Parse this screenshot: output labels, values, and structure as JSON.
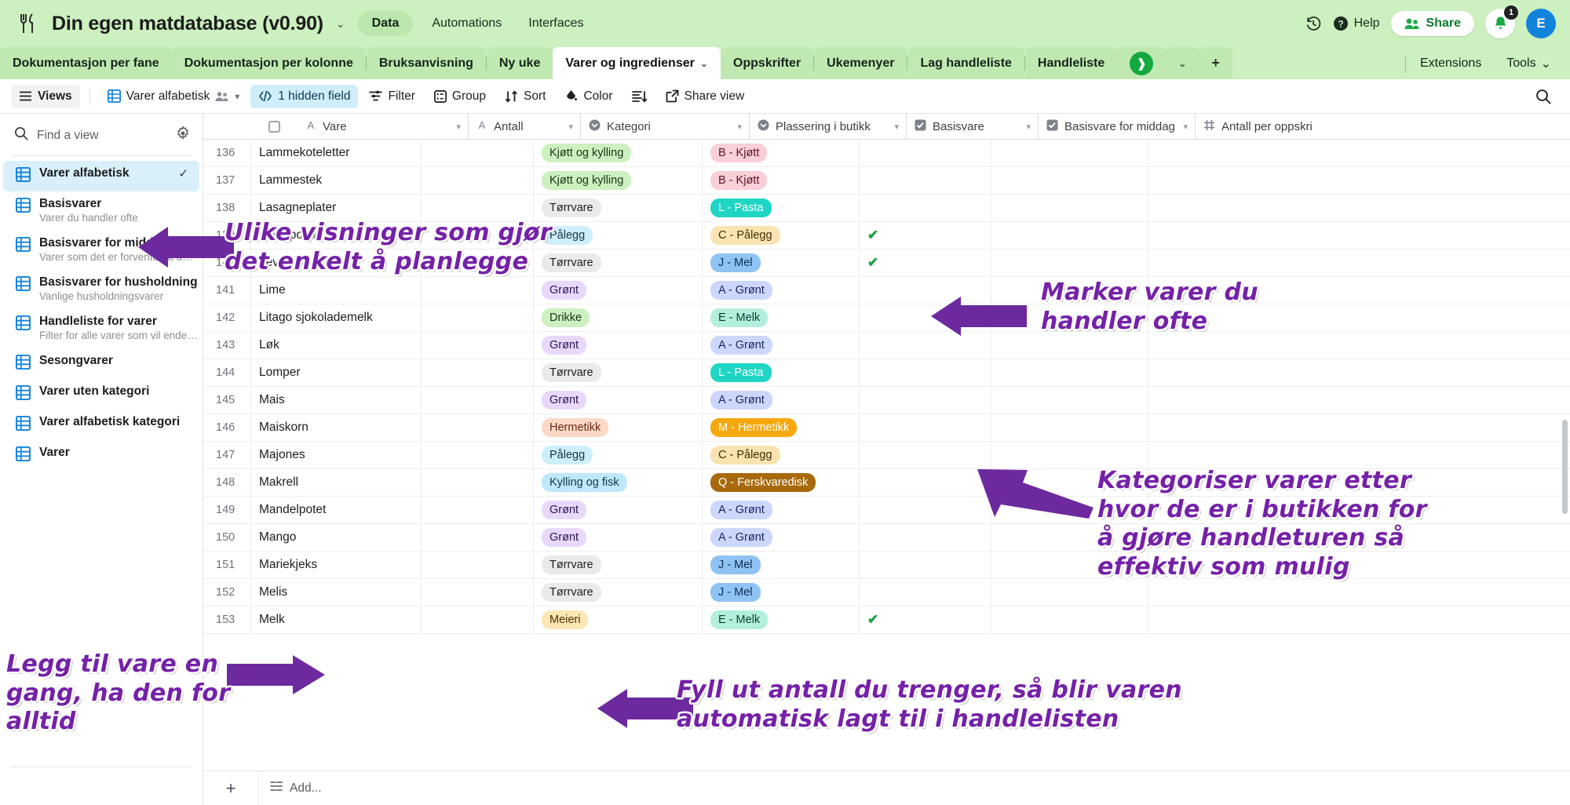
{
  "header": {
    "brand_icon": "fork-knife-icon",
    "title": "Din egen matdatabase (v0.90)",
    "title_caret": "⌄",
    "nav": [
      {
        "label": "Data",
        "active": true
      },
      {
        "label": "Automations",
        "active": false
      },
      {
        "label": "Interfaces",
        "active": false
      }
    ],
    "history_icon": "history-clock-icon",
    "help_label": "Help",
    "share_label": "Share",
    "notification_count": "1",
    "avatar_initial": "E"
  },
  "tabs": {
    "items": [
      {
        "label": "Dokumentasjon per fane",
        "state": "shaded"
      },
      {
        "label": "Dokumentasjon per kolonne",
        "state": "normal"
      },
      {
        "label": "Bruksanvisning",
        "state": "normal"
      },
      {
        "label": "Ny uke",
        "state": "normal"
      },
      {
        "label": "Varer og ingredienser",
        "state": "active"
      },
      {
        "label": "Oppskrifter",
        "state": "normal"
      },
      {
        "label": "Ukemenyer",
        "state": "normal"
      },
      {
        "label": "Lag handleliste",
        "state": "normal"
      },
      {
        "label": "Handleliste",
        "state": "normal"
      }
    ],
    "overflow_caret": "⌄",
    "add_label": "+",
    "extensions_label": "Extensions",
    "tools_label": "Tools",
    "tools_caret": "⌄"
  },
  "toolbar": {
    "views_label": "Views",
    "view_name": "Varer alfabetisk",
    "view_collaborators_icon": "people-icon",
    "view_caret": "▾",
    "hidden_field_label": "1 hidden field",
    "filter_label": "Filter",
    "group_label": "Group",
    "sort_label": "Sort",
    "color_label": "Color",
    "row_height_icon": "row-height-icon",
    "share_view_label": "Share view",
    "search_icon": "search-icon"
  },
  "sidebar": {
    "find_placeholder": "Find a view",
    "settings_icon": "gear-icon",
    "views": [
      {
        "name": "Varer alfabetisk",
        "sub": "",
        "selected": true,
        "checked": true
      },
      {
        "name": "Basisvarer",
        "sub": "Varer du handler ofte",
        "selected": false,
        "checked": false
      },
      {
        "name": "Basisvarer for middag",
        "sub": "Varer som det er forventet at d…",
        "selected": false,
        "checked": false
      },
      {
        "name": "Basisvarer for husholdning",
        "sub": "Vanlige husholdningsvarer",
        "selected": false,
        "checked": false
      },
      {
        "name": "Handleliste for varer",
        "sub": "Filter for alle varer som vil ende…",
        "selected": false,
        "checked": false
      },
      {
        "name": "Sesongvarer",
        "sub": "",
        "selected": false,
        "checked": false
      },
      {
        "name": "Varer uten kategori",
        "sub": "",
        "selected": false,
        "checked": false
      },
      {
        "name": "Varer alfabetisk kategori",
        "sub": "",
        "selected": false,
        "checked": false
      },
      {
        "name": "Varer",
        "sub": "",
        "selected": false,
        "checked": false
      }
    ]
  },
  "grid": {
    "columns": [
      {
        "label": "Vare",
        "icon": "text-field-icon",
        "caret": "▾"
      },
      {
        "label": "Antall",
        "icon": "text-field-icon",
        "caret": "▾"
      },
      {
        "label": "Kategori",
        "icon": "single-select-icon",
        "caret": "▾"
      },
      {
        "label": "Plassering i butikk",
        "icon": "single-select-icon",
        "caret": "▾"
      },
      {
        "label": "Basisvare",
        "icon": "checkbox-icon",
        "caret": "▾"
      },
      {
        "label": "Basisvare for middag",
        "icon": "checkbox-icon",
        "caret": "▾"
      },
      {
        "label": "Antall per oppskri",
        "icon": "plus-field-icon",
        "caret": ""
      }
    ],
    "rows": [
      {
        "num": "136",
        "vare": "Lammekoteletter",
        "antall": "",
        "kategori": "Kjøtt og kylling",
        "kat_style": "green",
        "plassering": "B - Kjøtt",
        "plass_style": "pink",
        "basisvare": "",
        "basisvare_middag": "",
        "antall_per": ""
      },
      {
        "num": "137",
        "vare": "Lammestek",
        "antall": "",
        "kategori": "Kjøtt og kylling",
        "kat_style": "green",
        "plassering": "B - Kjøtt",
        "plass_style": "pink",
        "basisvare": "",
        "basisvare_middag": "",
        "antall_per": ""
      },
      {
        "num": "138",
        "vare": "Lasagneplater",
        "antall": "",
        "kategori": "Tørrvare",
        "kat_style": "gray",
        "plassering": "L - Pasta",
        "plass_style": "teal",
        "basisvare": "",
        "basisvare_middag": "",
        "antall_per": ""
      },
      {
        "num": "139",
        "vare": "Leverpostei",
        "antall": "",
        "kategori": "Pålegg",
        "kat_style": "lightblue",
        "plassering": "C - Pålegg",
        "plass_style": "cream",
        "basisvare": "✔",
        "basisvare_middag": "",
        "antall_per": ""
      },
      {
        "num": "140",
        "vare": "Leverpostei gul",
        "antall": "",
        "kategori": "Tørrvare",
        "kat_style": "gray",
        "plassering": "J - Mel",
        "plass_style": "blue",
        "basisvare": "✔",
        "basisvare_middag": "",
        "antall_per": ""
      },
      {
        "num": "141",
        "vare": "Lime",
        "antall": "",
        "kategori": "Grønt",
        "kat_style": "purple",
        "plassering": "A - Grønt",
        "plass_style": "periwinkle",
        "basisvare": "",
        "basisvare_middag": "",
        "antall_per": ""
      },
      {
        "num": "142",
        "vare": "Litago sjokolademelk",
        "antall": "",
        "kategori": "Drikke",
        "kat_style": "green",
        "plassering": "E - Melk",
        "plass_style": "mint",
        "basisvare": "",
        "basisvare_middag": "",
        "antall_per": ""
      },
      {
        "num": "143",
        "vare": "Løk",
        "antall": "",
        "kategori": "Grønt",
        "kat_style": "purple",
        "plassering": "A - Grønt",
        "plass_style": "periwinkle",
        "basisvare": "",
        "basisvare_middag": "",
        "antall_per": ""
      },
      {
        "num": "144",
        "vare": "Lomper",
        "antall": "",
        "kategori": "Tørrvare",
        "kat_style": "gray",
        "plassering": "L - Pasta",
        "plass_style": "teal",
        "basisvare": "",
        "basisvare_middag": "",
        "antall_per": ""
      },
      {
        "num": "145",
        "vare": "Mais",
        "antall": "",
        "kategori": "Grønt",
        "kat_style": "purple",
        "plassering": "A - Grønt",
        "plass_style": "periwinkle",
        "basisvare": "",
        "basisvare_middag": "",
        "antall_per": ""
      },
      {
        "num": "146",
        "vare": "Maiskorn",
        "antall": "",
        "kategori": "Hermetikk",
        "kat_style": "peach",
        "plassering": "M - Hermetikk",
        "plass_style": "orange",
        "basisvare": "",
        "basisvare_middag": "",
        "antall_per": ""
      },
      {
        "num": "147",
        "vare": "Majones",
        "antall": "",
        "kategori": "Pålegg",
        "kat_style": "lightblue",
        "plassering": "C - Pålegg",
        "plass_style": "cream",
        "basisvare": "",
        "basisvare_middag": "",
        "antall_per": ""
      },
      {
        "num": "148",
        "vare": "Makrell",
        "antall": "",
        "kategori": "Kylling og fisk",
        "kat_style": "skyblue",
        "plassering": "Q - Ferskvaredisk",
        "plass_style": "brown",
        "basisvare": "",
        "basisvare_middag": "",
        "antall_per": ""
      },
      {
        "num": "149",
        "vare": "Mandelpotet",
        "antall": "",
        "kategori": "Grønt",
        "kat_style": "purple",
        "plassering": "A - Grønt",
        "plass_style": "periwinkle",
        "basisvare": "",
        "basisvare_middag": "",
        "antall_per": ""
      },
      {
        "num": "150",
        "vare": "Mango",
        "antall": "",
        "kategori": "Grønt",
        "kat_style": "purple",
        "plassering": "A - Grønt",
        "plass_style": "periwinkle",
        "basisvare": "",
        "basisvare_middag": "",
        "antall_per": ""
      },
      {
        "num": "151",
        "vare": "Mariekjeks",
        "antall": "",
        "kategori": "Tørrvare",
        "kat_style": "gray",
        "plassering": "J - Mel",
        "plass_style": "blue",
        "basisvare": "",
        "basisvare_middag": "",
        "antall_per": ""
      },
      {
        "num": "152",
        "vare": "Melis",
        "antall": "",
        "kategori": "Tørrvare",
        "kat_style": "gray",
        "plassering": "J - Mel",
        "plass_style": "blue",
        "basisvare": "",
        "basisvare_middag": "",
        "antall_per": ""
      },
      {
        "num": "153",
        "vare": "Melk",
        "antall": "",
        "kategori": "Meieri",
        "kat_style": "cream2",
        "plassering": "E - Melk",
        "plass_style": "mint",
        "basisvare": "✔",
        "basisvare_middag": "",
        "antall_per": ""
      }
    ],
    "add_row_label": "Add...",
    "add_plus": "+"
  },
  "annotations": [
    {
      "id": "anno-views",
      "text": "Ulike visninger som gjør\ndet enkelt å planlegge"
    },
    {
      "id": "anno-basisvare",
      "text": "Marker varer du\nhandler ofte"
    },
    {
      "id": "anno-kategori",
      "text": "Kategoriser varer etter\nhvor de er i butikken for\nå gjøre handleturen så\neffektiv som mulig"
    },
    {
      "id": "anno-legg-til",
      "text": "Legg til vare en\ngang, ha den for\nalltid"
    },
    {
      "id": "anno-antall",
      "text": "Fyll ut antall du trenger, så blir varen\nautomatisk lagt til i handlelisten"
    }
  ],
  "colors": {
    "header_bg": "#cdf0c0",
    "accent_purple": "#7521a8",
    "selected_view_bg": "#d9f0fb",
    "hidden_field_bg": "#cfedfb",
    "check_green": "#1aa343",
    "avatar_blue": "#1283da"
  }
}
